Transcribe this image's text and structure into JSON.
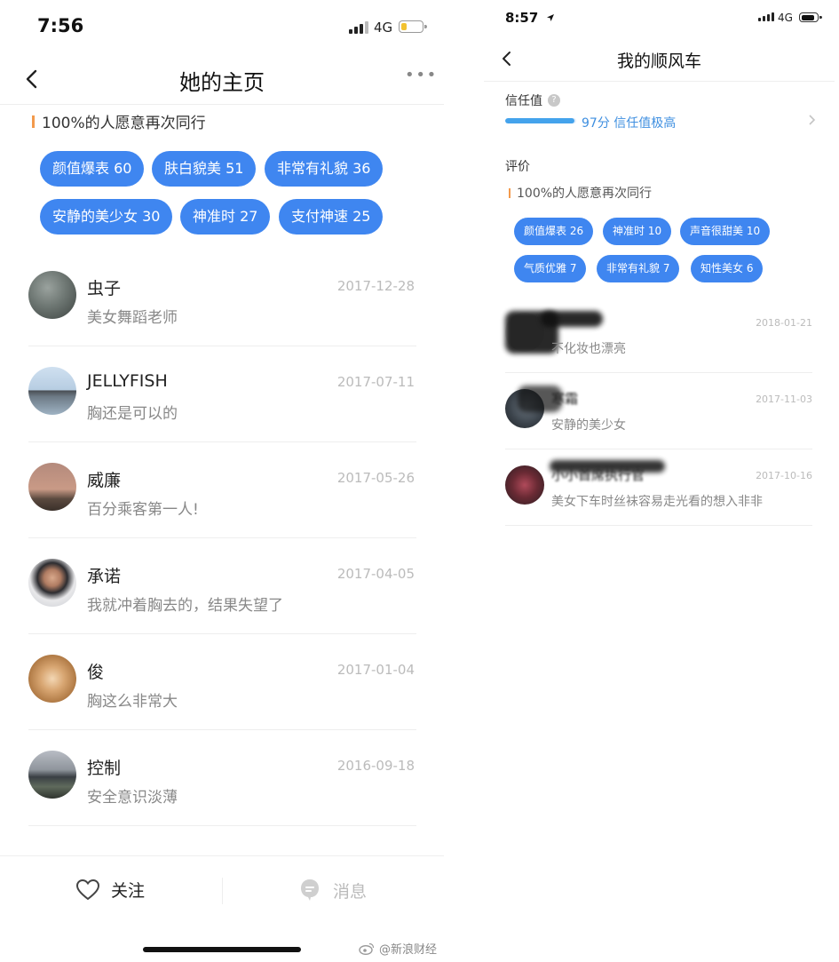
{
  "left": {
    "status": {
      "time": "7:56",
      "network": "4G",
      "battery_level": 0.25,
      "battery_color": "#f2c230"
    },
    "title": "她的主页",
    "again_text": "100%的人愿意再次同行",
    "tags": [
      {
        "label": "颜值爆表 60"
      },
      {
        "label": "肤白貌美 51"
      },
      {
        "label": "非常有礼貌 36"
      },
      {
        "label": "安静的美少女 30"
      },
      {
        "label": "神准时 27"
      },
      {
        "label": "支付神速 25"
      }
    ],
    "reviews": [
      {
        "name": "虫子",
        "date": "2017-12-28",
        "comment": "美女舞蹈老师"
      },
      {
        "name": "JELLYFISH",
        "date": "2017-07-11",
        "comment": "胸还是可以的"
      },
      {
        "name": "威廉",
        "date": "2017-05-26",
        "comment": "百分乘客第一人!"
      },
      {
        "name": "承诺",
        "date": "2017-04-05",
        "comment": "我就冲着胸去的，结果失望了"
      },
      {
        "name": "俊",
        "date": "2017-01-04",
        "comment": "胸这么非常大"
      },
      {
        "name": "控制",
        "date": "2016-09-18",
        "comment": "安全意识淡薄"
      }
    ],
    "bottom": {
      "follow_label": "关注",
      "message_label": "消息"
    }
  },
  "right": {
    "status": {
      "time": "8:57",
      "network": "4G",
      "battery_level": 0.85,
      "battery_color": "#111111"
    },
    "title": "我的顺风车",
    "trust_label": "信任值",
    "trust_score": 97,
    "trust_text": "97分 信任值极高",
    "eval_label": "评价",
    "again_text": "100%的人愿意再次同行",
    "tags": [
      {
        "label": "颜值爆表 26"
      },
      {
        "label": "神准时 10"
      },
      {
        "label": "声音很甜美 10"
      },
      {
        "label": "气质优雅 7"
      },
      {
        "label": "非常有礼貌 7"
      },
      {
        "label": "知性美女 6"
      }
    ],
    "reviews": [
      {
        "name": "",
        "date": "2018-01-21",
        "comment": "不化妆也漂亮"
      },
      {
        "name": "寒霜",
        "date": "2017-11-03",
        "comment": "安静的美少女"
      },
      {
        "name": "小小首席执行官",
        "date": "2017-10-16",
        "comment": "美女下车时丝袜容易走光看的想入非非"
      }
    ]
  },
  "watermark": "@新浪财经",
  "colors": {
    "accent": "#3f86f0",
    "trust_bar": "#44a3ec",
    "marker": "#f39a4c"
  }
}
